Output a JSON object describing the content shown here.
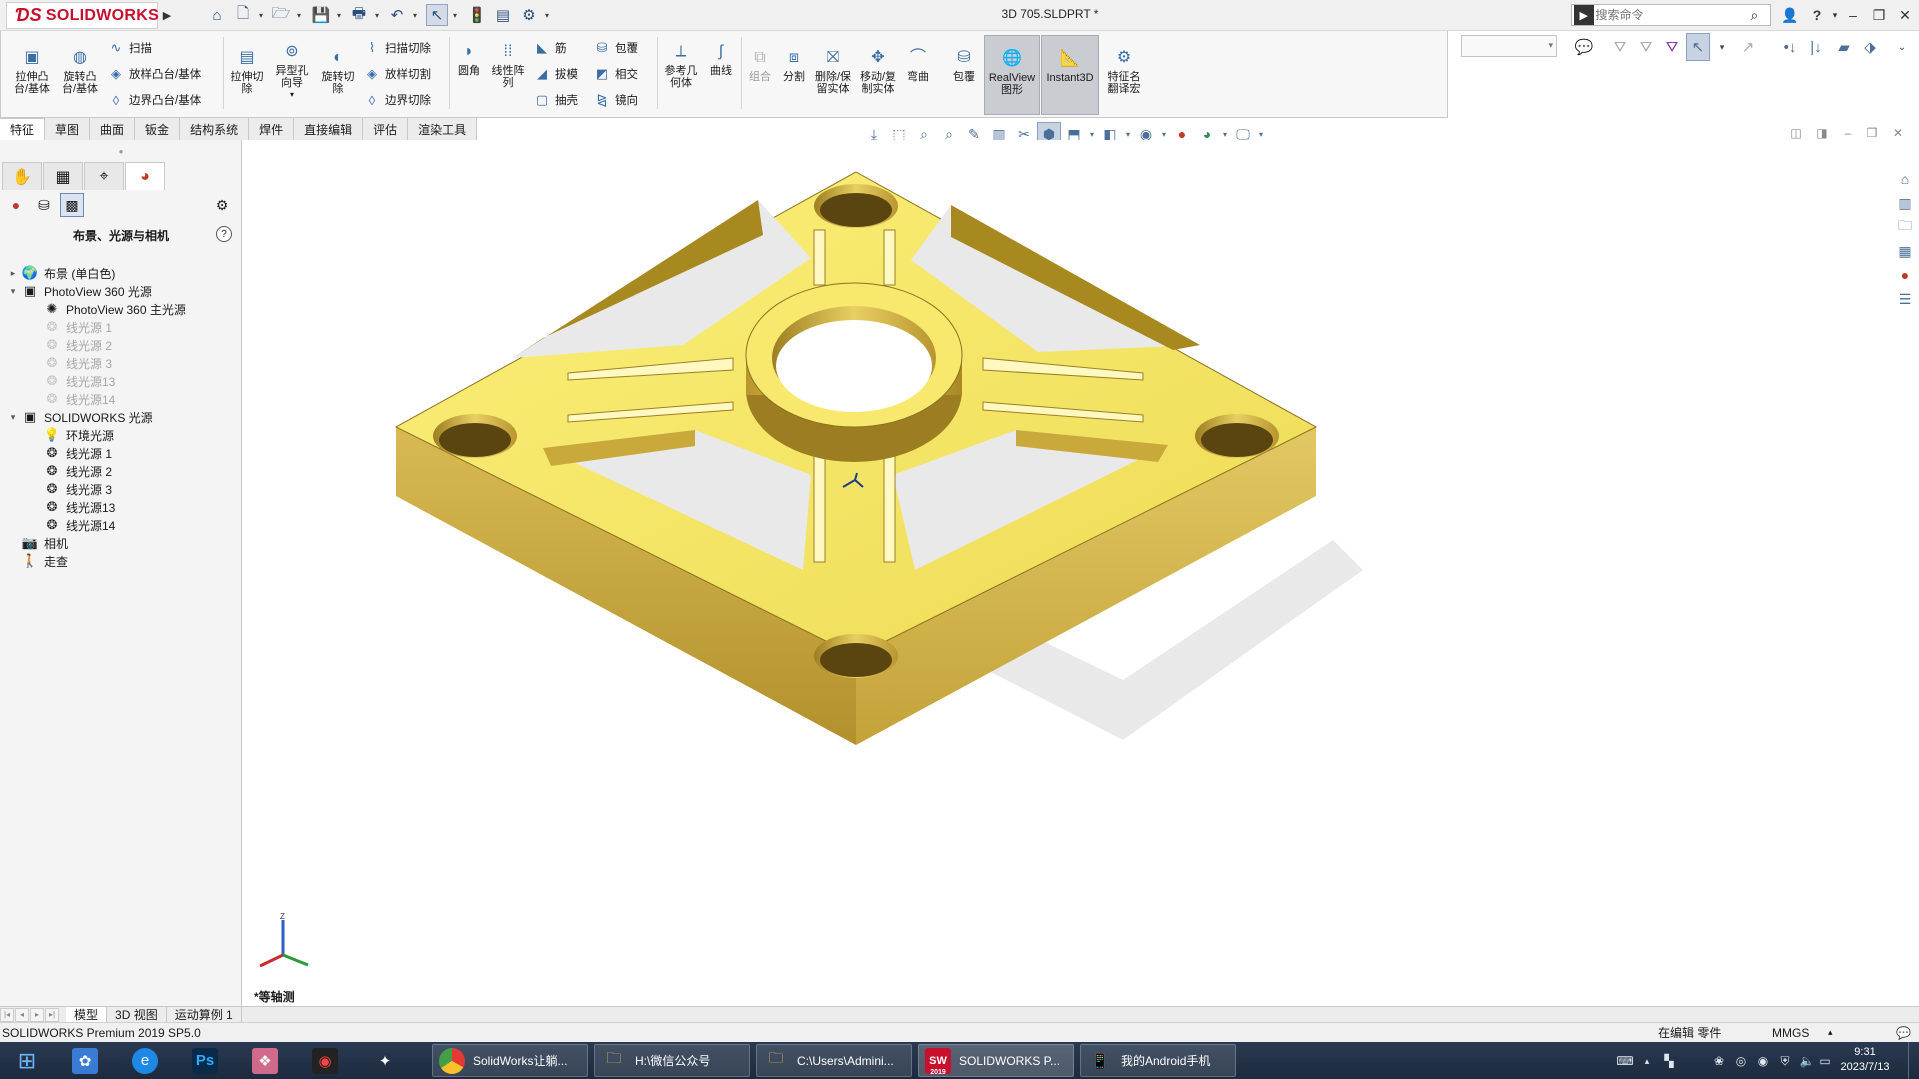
{
  "app": {
    "logo_text": "SOLIDWORKS",
    "document_title": "3D 705.SLDPRT *",
    "search_placeholder": "搜索命令"
  },
  "ribbon": {
    "big_buttons": [
      {
        "label": "拉伸凸\n台/基体",
        "icon": "extrude-boss-icon"
      },
      {
        "label": "旋转凸\n台/基体",
        "icon": "revolve-boss-icon"
      },
      {
        "label": "拉伸切\n除",
        "icon": "extrude-cut-icon"
      },
      {
        "label": "异型孔\n向导",
        "icon": "hole-wizard-icon"
      },
      {
        "label": "旋转切\n除",
        "icon": "revolve-cut-icon"
      },
      {
        "label": "圆角",
        "icon": "fillet-icon"
      },
      {
        "label": "线性阵\n列",
        "icon": "linear-pattern-icon"
      },
      {
        "label": "参考几\n何体",
        "icon": "reference-geometry-icon"
      },
      {
        "label": "曲线",
        "icon": "curves-icon"
      },
      {
        "label": "组合",
        "icon": "combine-icon"
      },
      {
        "label": "分割",
        "icon": "split-icon"
      },
      {
        "label": "删除/保\n留实体",
        "icon": "delete-body-icon"
      },
      {
        "label": "移动/复\n制实体",
        "icon": "move-copy-body-icon"
      },
      {
        "label": "弯曲",
        "icon": "flex-icon"
      },
      {
        "label": "包覆",
        "icon": "wrap-big-icon"
      },
      {
        "label": "RealView\n图形",
        "icon": "realview-icon"
      },
      {
        "label": "Instant3D",
        "icon": "instant3d-icon"
      },
      {
        "label": "特征名\n翻译宏",
        "icon": "macro-icon"
      }
    ],
    "small_buttons": {
      "sweep": "扫描",
      "loft_boss": "放样凸台/基体",
      "boundary_boss": "边界凸台/基体",
      "swept_cut": "扫描切除",
      "lofted_cut": "放样切割",
      "boundary_cut": "边界切除",
      "rib": "筋",
      "draft": "拔模",
      "shell": "抽壳",
      "wrap": "包覆",
      "intersect": "相交",
      "mirror": "镜向"
    }
  },
  "tabs": [
    "特征",
    "草图",
    "曲面",
    "钣金",
    "结构系统",
    "焊件",
    "直接编辑",
    "评估",
    "渲染工具"
  ],
  "active_tab": "特征",
  "panel": {
    "title": "布景、光源与相机",
    "tree": [
      {
        "label": "布景 (单白色)",
        "level": 0,
        "expander": "▸",
        "icon": "scene-icon",
        "grey": false
      },
      {
        "label": "PhotoView 360 光源",
        "level": 0,
        "expander": "▾",
        "icon": "photoview-lights-icon",
        "grey": false
      },
      {
        "label": "PhotoView 360 主光源",
        "level": 1,
        "expander": "",
        "icon": "photoview-primary-light-icon",
        "grey": false
      },
      {
        "label": "线光源 1",
        "level": 1,
        "expander": "",
        "icon": "spot-light-icon",
        "grey": true
      },
      {
        "label": "线光源 2",
        "level": 1,
        "expander": "",
        "icon": "spot-light-icon",
        "grey": true
      },
      {
        "label": "线光源 3",
        "level": 1,
        "expander": "",
        "icon": "spot-light-icon",
        "grey": true
      },
      {
        "label": "线光源13",
        "level": 1,
        "expander": "",
        "icon": "spot-light-icon",
        "grey": true
      },
      {
        "label": "线光源14",
        "level": 1,
        "expander": "",
        "icon": "spot-light-icon",
        "grey": true
      },
      {
        "label": "SOLIDWORKS 光源",
        "level": 0,
        "expander": "▾",
        "icon": "solidworks-lights-icon",
        "grey": false
      },
      {
        "label": "环境光源",
        "level": 1,
        "expander": "",
        "icon": "ambient-light-icon",
        "grey": false
      },
      {
        "label": "线光源 1",
        "level": 1,
        "expander": "",
        "icon": "spot-light-icon",
        "grey": false
      },
      {
        "label": "线光源 2",
        "level": 1,
        "expander": "",
        "icon": "spot-light-icon",
        "grey": false
      },
      {
        "label": "线光源 3",
        "level": 1,
        "expander": "",
        "icon": "spot-light-icon",
        "grey": false
      },
      {
        "label": "线光源13",
        "level": 1,
        "expander": "",
        "icon": "spot-light-icon",
        "grey": false
      },
      {
        "label": "线光源14",
        "level": 1,
        "expander": "",
        "icon": "spot-light-icon",
        "grey": false
      },
      {
        "label": "相机",
        "level": 0,
        "expander": "",
        "icon": "camera-icon",
        "grey": false
      },
      {
        "label": "走查",
        "level": 0,
        "expander": "",
        "icon": "walkthrough-icon",
        "grey": false
      }
    ]
  },
  "viewport": {
    "view_label": "*等轴测",
    "model_color": "#F2E262",
    "model_dark": "#B8982E"
  },
  "bottom_tabs": [
    "模型",
    "3D 视图",
    "运动算例 1"
  ],
  "status": {
    "product": "SOLIDWORKS Premium 2019 SP5.0",
    "mode": "在编辑 零件",
    "units": "MMGS"
  },
  "taskbar": {
    "items": [
      {
        "label": "SolidWorks让躺...",
        "icon": "chrome-icon"
      },
      {
        "label": "H:\\微信公众号",
        "icon": "folder-icon"
      },
      {
        "label": "C:\\Users\\Admini...",
        "icon": "folder-icon"
      },
      {
        "label": "SOLIDWORKS P...",
        "icon": "solidworks-app-icon"
      },
      {
        "label": "我的Android手机",
        "icon": "phone-icon"
      }
    ],
    "sw_badge": "2019",
    "time": "9:31",
    "date": "2023/7/13"
  }
}
